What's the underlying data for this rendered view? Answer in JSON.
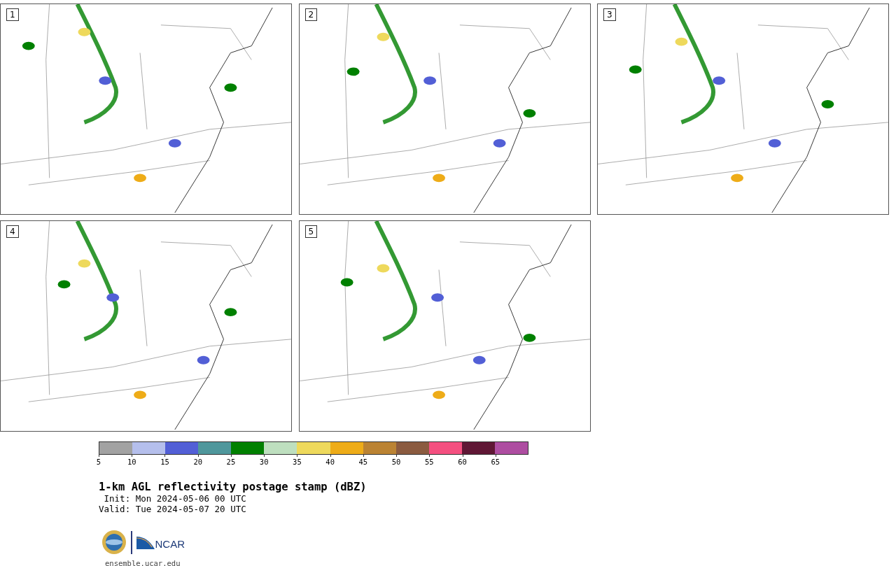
{
  "panels": [
    {
      "label": "1"
    },
    {
      "label": "2"
    },
    {
      "label": "3"
    },
    {
      "label": "4"
    },
    {
      "label": "5"
    }
  ],
  "colorbar": {
    "bins": [
      {
        "label": "5",
        "color": "#a2a2a2"
      },
      {
        "label": "10",
        "color": "#b5bfec"
      },
      {
        "label": "15",
        "color": "#525fd6"
      },
      {
        "label": "20",
        "color": "#4f979c"
      },
      {
        "label": "25",
        "color": "#008000"
      },
      {
        "label": "30",
        "color": "#bedfbf"
      },
      {
        "label": "35",
        "color": "#eed95c"
      },
      {
        "label": "40",
        "color": "#eeac18"
      },
      {
        "label": "45",
        "color": "#bb8333"
      },
      {
        "label": "50",
        "color": "#8b5b40"
      },
      {
        "label": "55",
        "color": "#f45080"
      },
      {
        "label": "60",
        "color": "#601735"
      },
      {
        "label": "65",
        "color": "#ae4da1"
      }
    ]
  },
  "title": "1-km AGL reflectivity postage stamp (dBZ)",
  "init": " Init: Mon 2024-05-06 00 UTC",
  "valid": "Valid: Tue 2024-05-07 20 UTC",
  "logo": {
    "text": "NCAR"
  },
  "footer": "ensemble.ucar.edu"
}
